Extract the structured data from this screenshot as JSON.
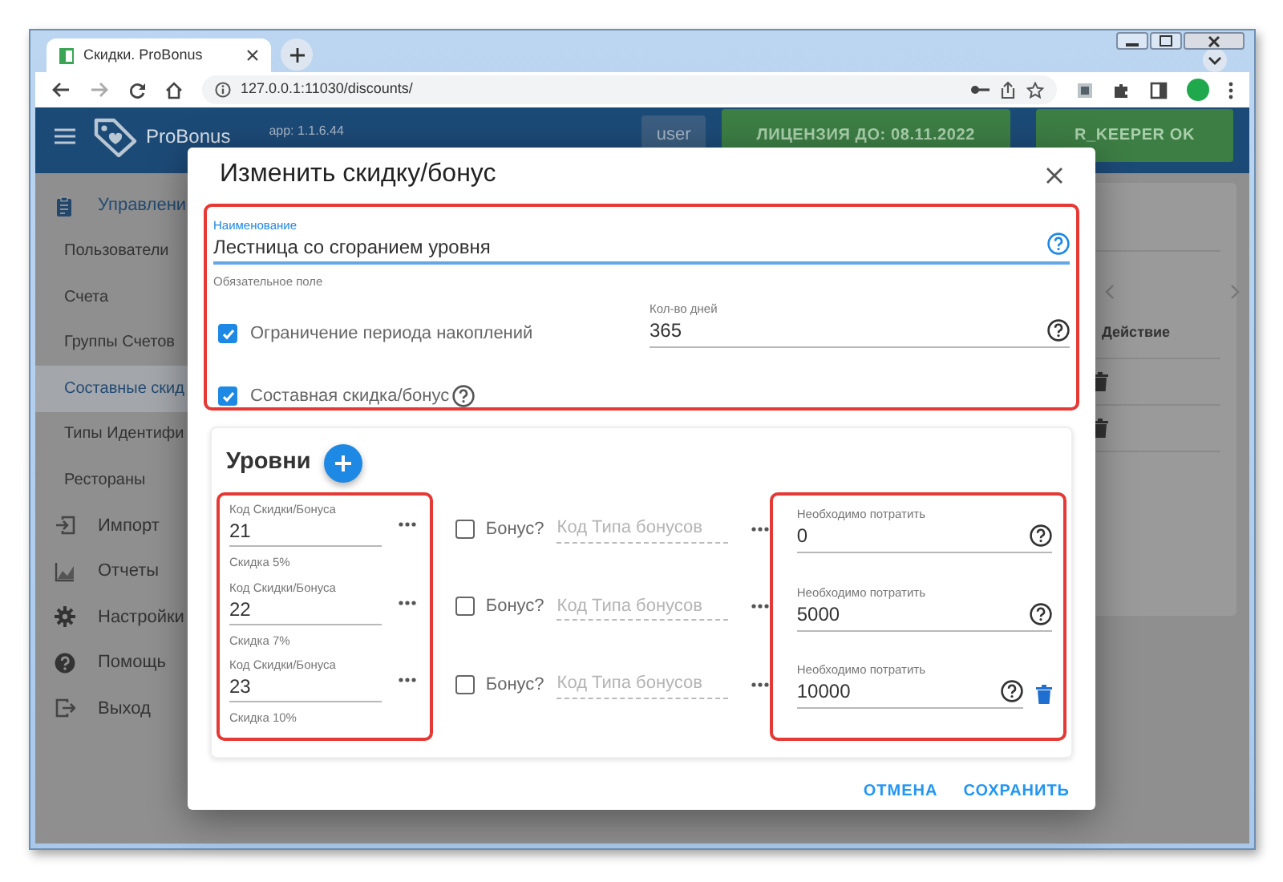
{
  "browser": {
    "tab_title": "Скидки. ProBonus",
    "url": "127.0.0.1:11030/discounts/"
  },
  "app": {
    "brand": "ProBonus",
    "version": "app: 1.1.6.44",
    "user": "user",
    "license": "ЛИЦЕНЗИЯ ДО: 08.11.2022",
    "status": "R_KEEPER OK"
  },
  "sidebar": [
    {
      "label": "Управлени",
      "kind": "section",
      "selected": false
    },
    {
      "label": "Пользователи",
      "kind": "sub",
      "selected": false
    },
    {
      "label": "Счета",
      "kind": "sub",
      "selected": false
    },
    {
      "label": "Группы Счетов",
      "kind": "sub",
      "selected": false
    },
    {
      "label": "Составные скид",
      "kind": "sub",
      "selected": true
    },
    {
      "label": "Типы Идентифи",
      "kind": "sub",
      "selected": false
    },
    {
      "label": "Рестораны",
      "kind": "sub",
      "selected": false
    },
    {
      "label": "Импорт",
      "kind": "main",
      "selected": false
    },
    {
      "label": "Отчеты",
      "kind": "main",
      "selected": false
    },
    {
      "label": "Настройки",
      "kind": "main",
      "selected": false
    },
    {
      "label": "Помощь",
      "kind": "main",
      "selected": false
    },
    {
      "label": "Выход",
      "kind": "main",
      "selected": false
    }
  ],
  "table": {
    "column": "Действие",
    "rows": [
      {
        "deletable": true
      },
      {
        "deletable": true
      }
    ]
  },
  "dialog": {
    "title": "Изменить скидку/бонус",
    "name_field": {
      "label": "Наименование",
      "value": "Лестница со сгоранием уровня",
      "helper": "Обязательное поле"
    },
    "limit_checkbox": {
      "label": "Ограничение периода накоплений",
      "checked": true
    },
    "days_field": {
      "label": "Кол-во дней",
      "value": "365"
    },
    "composite_checkbox": {
      "label": "Составная скидка/бонус",
      "checked": true
    },
    "levels": {
      "title": "Уровни",
      "rows": [
        {
          "code_label": "Код Скидки/Бонуса",
          "code": "21",
          "code_helper": "Скидка 5%",
          "bonus_checked": false,
          "bonus_label": "Бонус?",
          "bonus_type_placeholder": "Код Типа бонусов",
          "spend_label": "Необходимо потратить",
          "spend": "0",
          "deletable": false
        },
        {
          "code_label": "Код Скидки/Бонуса",
          "code": "22",
          "code_helper": "Скидка 7%",
          "bonus_checked": false,
          "bonus_label": "Бонус?",
          "bonus_type_placeholder": "Код Типа бонусов",
          "spend_label": "Необходимо потратить",
          "spend": "5000",
          "deletable": false
        },
        {
          "code_label": "Код Скидки/Бонуса",
          "code": "23",
          "code_helper": "Скидка 10%",
          "bonus_checked": false,
          "bonus_label": "Бонус?",
          "bonus_type_placeholder": "Код Типа бонусов",
          "spend_label": "Необходимо потратить",
          "spend": "10000",
          "deletable": true
        }
      ]
    },
    "buttons": [
      "ОТМЕНА",
      "СОХРАНИТЬ"
    ]
  }
}
